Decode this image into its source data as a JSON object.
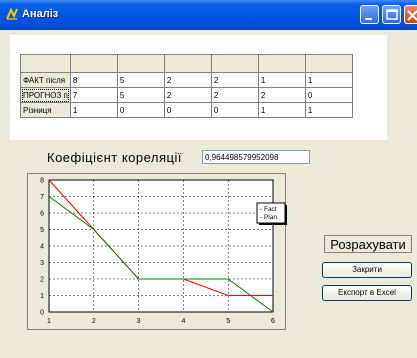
{
  "window": {
    "title": "Аналіз"
  },
  "table": {
    "rows": [
      {
        "label": "ФАКТ після",
        "values": [
          "8",
          "5",
          "2",
          "2",
          "1",
          "1"
        ]
      },
      {
        "label": "ПРОГНОЗ п",
        "values": [
          "7",
          "5",
          "2",
          "2",
          "2",
          "0"
        ]
      },
      {
        "label": "Різниця",
        "values": [
          "1",
          "0",
          "0",
          "0",
          "1",
          "1"
        ]
      }
    ]
  },
  "correlation": {
    "label": "Коефіцієнт кореляції",
    "value": "0,964498579952098"
  },
  "buttons": {
    "calculate": "Розрахувати",
    "close": "Закрити",
    "export": "Експорт в Excel"
  },
  "chart_data": {
    "type": "line",
    "x": [
      1,
      2,
      3,
      4,
      5,
      6
    ],
    "series": [
      {
        "name": "Fact",
        "values": [
          8,
          5,
          2,
          2,
          1,
          1
        ],
        "color": "#ff0000"
      },
      {
        "name": "Plan",
        "values": [
          7,
          5,
          2,
          2,
          2,
          0
        ],
        "color": "#008000"
      }
    ],
    "xlim": [
      1,
      6
    ],
    "ylim": [
      0,
      8
    ],
    "xticks": [
      "1",
      "2",
      "3",
      "4",
      "5",
      "6"
    ],
    "yticks": [
      "0",
      "1",
      "2",
      "3",
      "4",
      "5",
      "6",
      "7",
      "8"
    ],
    "grid": true,
    "legend": "top-right"
  }
}
